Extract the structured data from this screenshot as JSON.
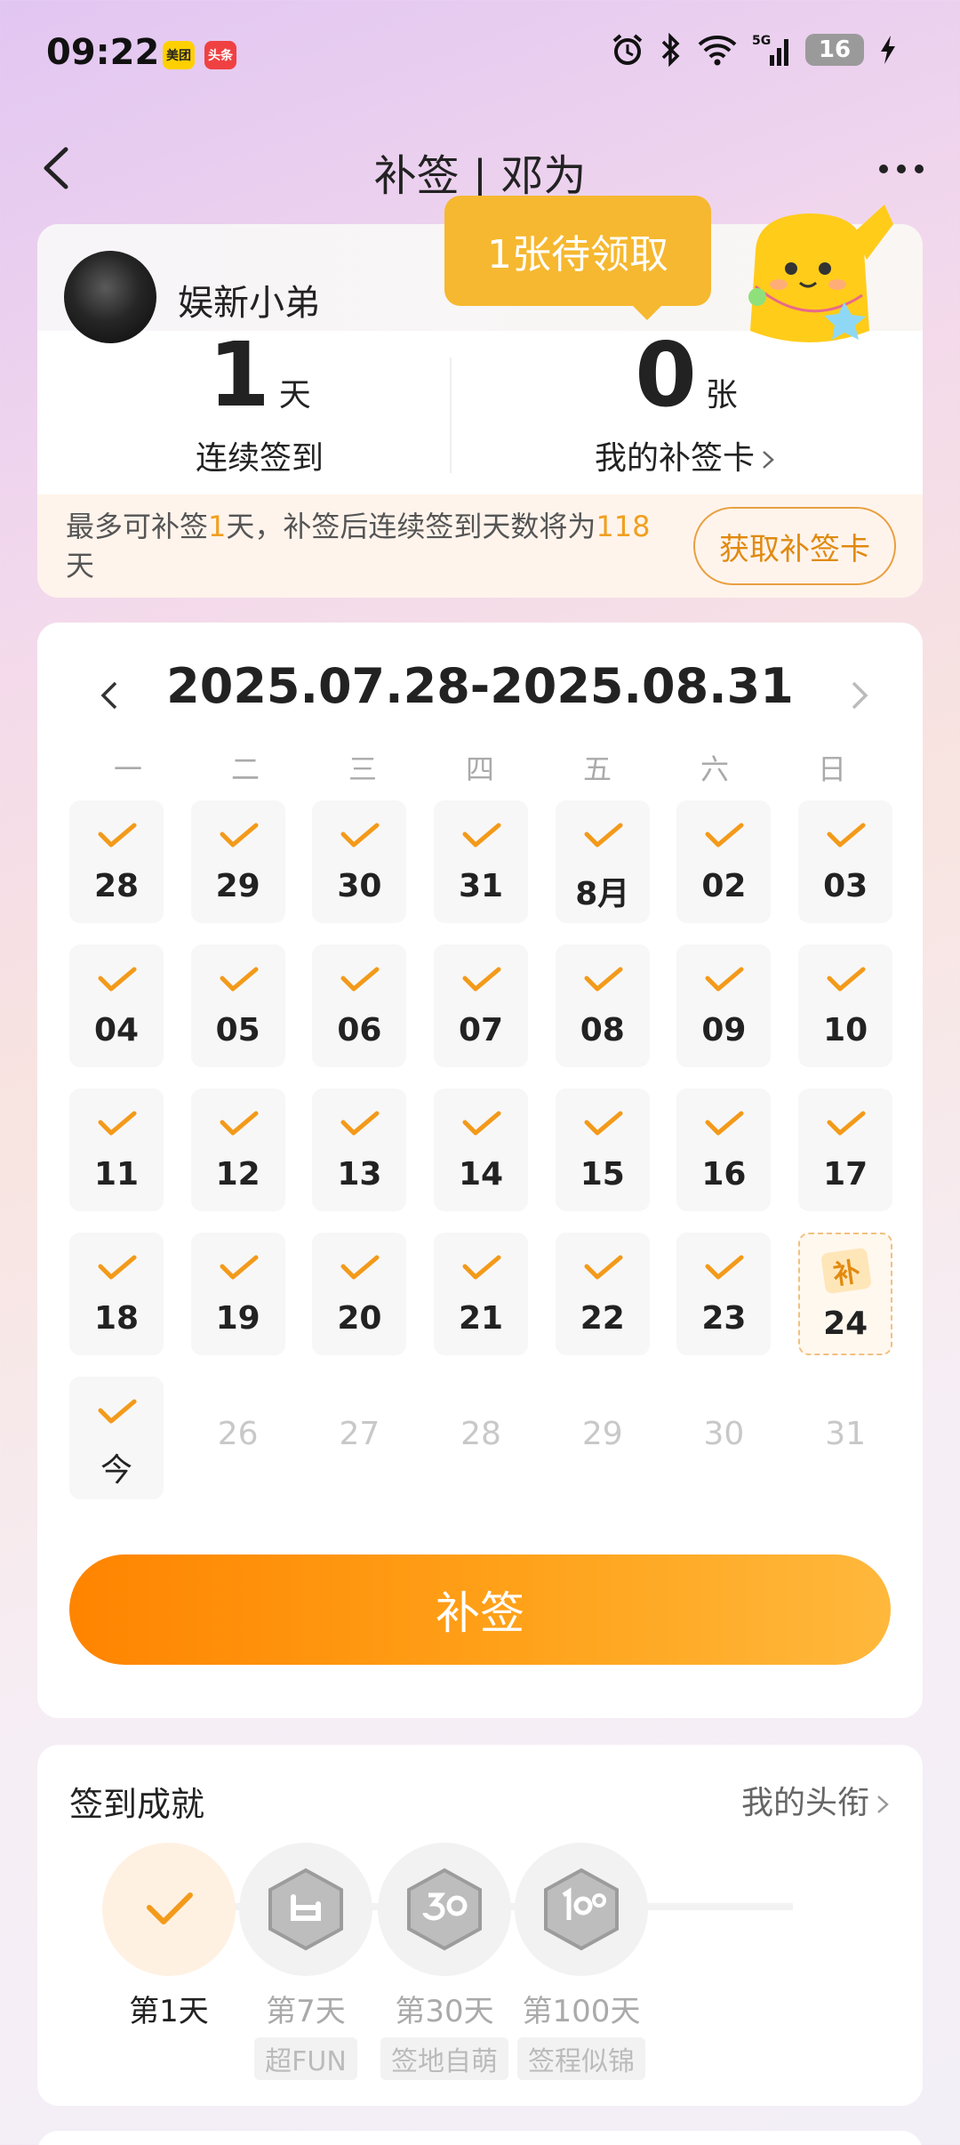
{
  "status_bar": {
    "time": "09:22",
    "app_badges": [
      "美团",
      "头条"
    ],
    "network": "5G",
    "battery": "16"
  },
  "nav": {
    "title": "补签 | 邓为"
  },
  "profile": {
    "username": "娱新小弟",
    "streak_num": "1",
    "streak_unit": "天",
    "streak_label": "连续签到",
    "cards_num": "0",
    "cards_unit": "张",
    "cards_label": "我的补签卡",
    "tooltip": "1张待领取",
    "info_prefix": "最多可补签",
    "info_days": "1",
    "info_mid": "天，补签后连续签到天数将为",
    "info_total": "118",
    "info_suffix": "天",
    "get_card_button": "获取补签卡"
  },
  "calendar": {
    "range": "2025.07.28-2025.08.31",
    "weekdays": [
      "一",
      "二",
      "三",
      "四",
      "五",
      "六",
      "日"
    ],
    "days": [
      {
        "label": "28",
        "state": "checked"
      },
      {
        "label": "29",
        "state": "checked"
      },
      {
        "label": "30",
        "state": "checked"
      },
      {
        "label": "31",
        "state": "checked"
      },
      {
        "label": "8月",
        "state": "checked"
      },
      {
        "label": "02",
        "state": "checked"
      },
      {
        "label": "03",
        "state": "checked"
      },
      {
        "label": "04",
        "state": "checked"
      },
      {
        "label": "05",
        "state": "checked"
      },
      {
        "label": "06",
        "state": "checked"
      },
      {
        "label": "07",
        "state": "checked"
      },
      {
        "label": "08",
        "state": "checked"
      },
      {
        "label": "09",
        "state": "checked"
      },
      {
        "label": "10",
        "state": "checked"
      },
      {
        "label": "11",
        "state": "checked"
      },
      {
        "label": "12",
        "state": "checked"
      },
      {
        "label": "13",
        "state": "checked"
      },
      {
        "label": "14",
        "state": "checked"
      },
      {
        "label": "15",
        "state": "checked"
      },
      {
        "label": "16",
        "state": "checked"
      },
      {
        "label": "17",
        "state": "checked"
      },
      {
        "label": "18",
        "state": "checked"
      },
      {
        "label": "19",
        "state": "checked"
      },
      {
        "label": "20",
        "state": "checked"
      },
      {
        "label": "21",
        "state": "checked"
      },
      {
        "label": "22",
        "state": "checked"
      },
      {
        "label": "23",
        "state": "checked"
      },
      {
        "label": "24",
        "state": "makeup",
        "tag": "补"
      },
      {
        "label": "今",
        "state": "today"
      },
      {
        "label": "26",
        "state": "future"
      },
      {
        "label": "27",
        "state": "future"
      },
      {
        "label": "28",
        "state": "future"
      },
      {
        "label": "29",
        "state": "future"
      },
      {
        "label": "30",
        "state": "future"
      },
      {
        "label": "31",
        "state": "future"
      }
    ],
    "makeup_button": "补签"
  },
  "achievements": {
    "title": "签到成就",
    "link": "我的头衔",
    "items": [
      {
        "day": "第1天",
        "name": "",
        "done": true
      },
      {
        "day": "第7天",
        "name": "超FUN",
        "done": false
      },
      {
        "day": "第30天",
        "name": "签地自萌",
        "done": false
      },
      {
        "day": "第100天",
        "name": "签程似锦",
        "done": false
      }
    ]
  },
  "colors": {
    "accent": "#ff8c00",
    "check": "#f39a1a",
    "tooltip": "#f6b830"
  }
}
